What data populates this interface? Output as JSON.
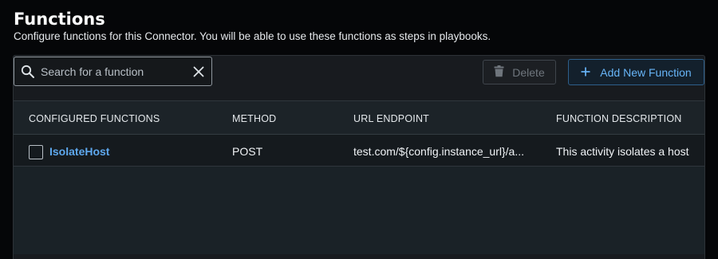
{
  "header": {
    "title": "Functions",
    "subtitle": "Configure functions for this Connector. You will be able to use these functions as steps in playbooks."
  },
  "search": {
    "placeholder": "Search for a function",
    "value": ""
  },
  "toolbar": {
    "delete_label": "Delete",
    "add_label": "Add New Function"
  },
  "table": {
    "columns": [
      "CONFIGURED FUNCTIONS",
      "METHOD",
      "URL ENDPOINT",
      "FUNCTION DESCRIPTION"
    ],
    "rows": [
      {
        "name": "IsolateHost",
        "method": "POST",
        "url": "test.com/${config.instance_url}/a...",
        "description": "This activity isolates a host"
      }
    ]
  },
  "colors": {
    "accent": "#5ea8ee",
    "background": "#050608",
    "panel": "#181b1f"
  },
  "icons": [
    "search-icon",
    "close-icon",
    "trash-icon",
    "plus-icon"
  ]
}
